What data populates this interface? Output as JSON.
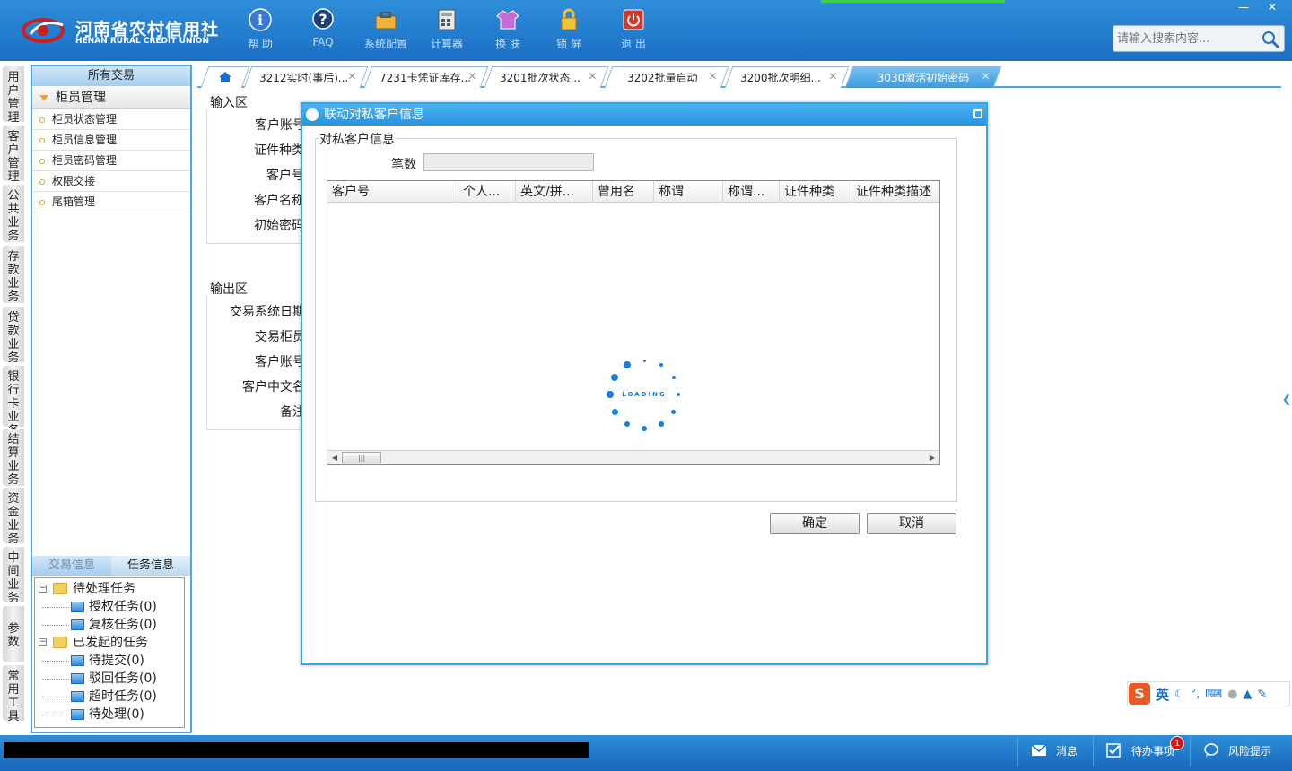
{
  "header": {
    "logo_cn": "河南省农村信用社",
    "logo_en": "HENAN RURAL CREDIT UNION",
    "tools": [
      {
        "label": "帮 助",
        "icon": "info-icon"
      },
      {
        "label": "FAQ",
        "icon": "faq-icon"
      },
      {
        "label": "系统配置",
        "icon": "toolbox-icon"
      },
      {
        "label": "计算器",
        "icon": "calculator-icon"
      },
      {
        "label": "换 肤",
        "icon": "shirt-icon"
      },
      {
        "label": "锁 屏",
        "icon": "lock-icon"
      },
      {
        "label": "退 出",
        "icon": "power-icon"
      }
    ],
    "search_placeholder": "请输入搜索内容..."
  },
  "vnav": [
    "用户管理",
    "客户管理",
    "公共业务",
    "存款业务",
    "贷款业务",
    "银行卡业务",
    "结算业务",
    "资金业务",
    "中间业务",
    "参数",
    "常用工具"
  ],
  "side": {
    "title": "所有交易",
    "group": "柜员管理",
    "items": [
      "柜员状态管理",
      "柜员信息管理",
      "柜员密码管理",
      "权限交接",
      "尾箱管理"
    ],
    "task_tabs": [
      "交易信息",
      "任务信息"
    ],
    "tree": {
      "pending": "待处理任务",
      "pending_children": [
        "授权任务(0)",
        "复核任务(0)"
      ],
      "initiated": "已发起的任务",
      "initiated_children": [
        "待提交(0)",
        "驳回任务(0)",
        "超时任务(0)",
        "待处理(0)"
      ]
    }
  },
  "tabs": [
    "3212实时(事后)...",
    "7231卡凭证库存...",
    "3201批次状态...",
    "3202批量启动",
    "3200批次明细...",
    "3030激活初始密码"
  ],
  "form": {
    "input_section": "输入区",
    "input_labels": [
      "客户账号",
      "证件种类",
      "客户号",
      "客户名称",
      "初始密码"
    ],
    "output_section": "输出区",
    "output_labels": [
      "交易系统日期",
      "交易柜员",
      "客户账号",
      "客户中文名",
      "备注"
    ]
  },
  "dialog": {
    "title": "联动对私客户信息",
    "group_label": "对私客户信息",
    "count_label": "笔数",
    "count_value": "",
    "columns": [
      "客户号",
      "个人...",
      "英文/拼...",
      "曾用名",
      "称谓",
      "称谓...",
      "证件种类",
      "证件种类描述"
    ],
    "loading_text": "LOADING",
    "ok_label": "确定",
    "cancel_label": "取消"
  },
  "footer": {
    "messages": "消息",
    "todo": "待办事项",
    "todo_badge": "1",
    "risk": "风险提示"
  },
  "ime": {
    "mode": "英"
  },
  "colors": {
    "header_blue": "#1a6fc4",
    "accent": "#3aa3e6",
    "tab_active": "#3b9be0"
  }
}
